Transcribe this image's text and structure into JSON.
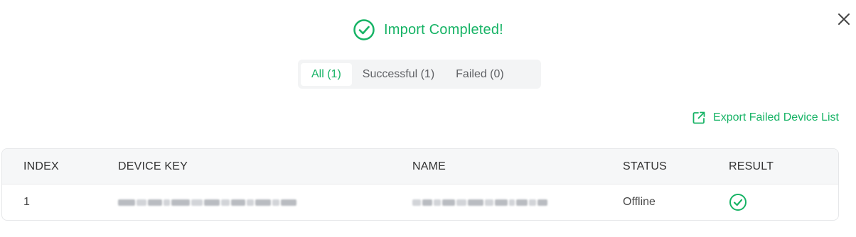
{
  "dialog": {
    "title": "Import Completed!",
    "icons": {
      "success": "check-circle-icon",
      "close": "close-icon",
      "export": "external-link-icon",
      "result": "check-circle-icon"
    },
    "colors": {
      "accent": "#16b365",
      "tab_bg": "#f3f4f5",
      "table_header_bg": "#f6f7f8"
    }
  },
  "tabs": [
    {
      "label": "All (1)",
      "active": true
    },
    {
      "label": "Successful (1)",
      "active": false
    },
    {
      "label": "Failed (0)",
      "active": false
    }
  ],
  "export": {
    "label": "Export Failed Device List"
  },
  "table": {
    "headers": {
      "index": "INDEX",
      "device_key": "DEVICE KEY",
      "name": "NAME",
      "status": "STATUS",
      "result": "RESULT"
    },
    "rows": [
      {
        "index": "1",
        "device_key_redacted": true,
        "name_redacted": true,
        "status": "Offline",
        "result": "success"
      }
    ]
  }
}
